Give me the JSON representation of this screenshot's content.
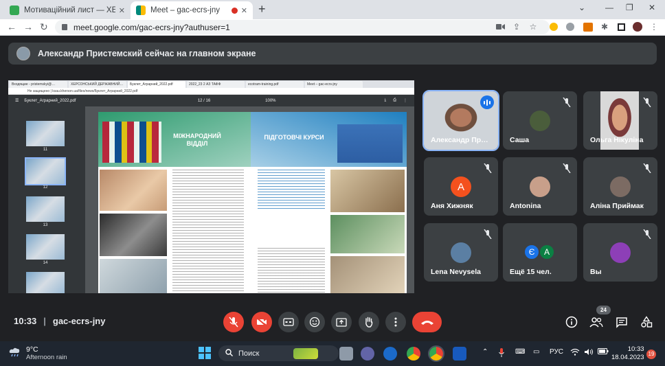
{
  "browser": {
    "tabs": [
      {
        "title": "Мотиваційний лист — ХЕРСОНСЬКИЙ",
        "favicon_color": "#34a853"
      },
      {
        "title": "Meet – gac-ecrs-jny",
        "favicon_color": "#00897b",
        "recording": true
      }
    ],
    "new_tab": "+",
    "url": "meet.google.com/gac-ecrs-jny?authuser=1",
    "window_controls": [
      "⌄",
      "—",
      "❐",
      "✕"
    ]
  },
  "banner": {
    "text": "Александр Пристемский сейчас на главном экране"
  },
  "presentation": {
    "inner_tabs": [
      "Входящие - pristemskyi@…",
      "ХЕРСОНСЬКИЙ ДЕРЖАВНИЙ…",
      "Буклет_Аграрний_2022.pdf",
      "2022_23 2 АЗ ТАФФ",
      "ecotram-training.pdf",
      "Meet – gac-ecrs-jny"
    ],
    "inner_url": "Не защищено | ksau.kherson.ua/files/news/Буклет_Аграрний_2022.pdf",
    "pdf_filename": "Буклет_Аграрний_2022.pdf",
    "pdf_page": "12 / 16",
    "pdf_zoom": "100%",
    "thumb_numbers": [
      "11",
      "12",
      "13",
      "14"
    ],
    "heading_left": "МІЖНАРОДНИЙ ВІДДІЛ",
    "heading_right": "ПІДГОТОВЧІ КУРСИ"
  },
  "participants": [
    {
      "name": "Александр Пр…",
      "speaking": true
    },
    {
      "name": "Саша",
      "muted": true,
      "avatar_color": "#4a5d3b"
    },
    {
      "name": "Ольга Нікуліна",
      "muted": true
    },
    {
      "name": "Аня Хижняк",
      "muted": true,
      "initial": "А",
      "avatar_color": "#f4511e"
    },
    {
      "name": "Antonina",
      "muted": true,
      "avatar_color": "#c89f8a"
    },
    {
      "name": "Аліна Приймак",
      "muted": true,
      "avatar_color": "#7c6b63"
    },
    {
      "name": "Lena Nevysela",
      "muted": true,
      "avatar_color": "#5b7fa3"
    },
    {
      "name": "Ещё 15 чел.",
      "initials": [
        "Є",
        "А"
      ],
      "colors": [
        "#1a73e8",
        "#0b8043"
      ]
    },
    {
      "name": "Вы",
      "muted": true,
      "avatar_color": "#8d3fb7"
    }
  ],
  "meeting": {
    "time": "10:33",
    "separator": "|",
    "code": "gac-ecrs-jny",
    "participant_count": "24"
  },
  "taskbar": {
    "weather_temp": "9°C",
    "weather_desc": "Afternoon rain",
    "search_label": "Поиск",
    "language": "РУС",
    "clock_time": "10:33",
    "clock_date": "18.04.2023",
    "notifications": "19"
  }
}
